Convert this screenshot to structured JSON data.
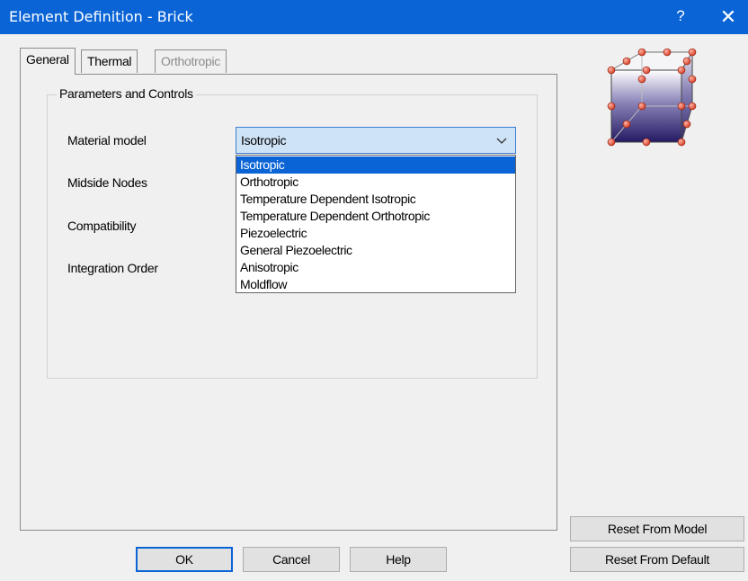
{
  "window": {
    "title": "Element Definition - Brick",
    "help_glyph": "?",
    "close_glyph": "✕"
  },
  "tabs": [
    {
      "label": "General",
      "state": "active"
    },
    {
      "label": "Thermal",
      "state": "normal"
    },
    {
      "label": "Orthotropic",
      "state": "disabled"
    }
  ],
  "group": {
    "title": "Parameters and Controls"
  },
  "fields": {
    "material_model": "Material model",
    "midside_nodes": "Midside Nodes",
    "compatibility": "Compatibility",
    "integration_order": "Integration Order"
  },
  "material_combo": {
    "value": "Isotropic",
    "options": [
      "Isotropic",
      "Orthotropic",
      "Temperature Dependent Isotropic",
      "Temperature Dependent Orthotropic",
      "Piezoelectric",
      "General Piezoelectric",
      "Anisotropic",
      "Moldflow"
    ],
    "selected_index": 0
  },
  "buttons": {
    "ok": "OK",
    "cancel": "Cancel",
    "help": "Help",
    "reset_model": "Reset From Model",
    "reset_default": "Reset From Default"
  },
  "colors": {
    "titlebar": "#0a64d6",
    "selection": "#0a64d6",
    "combo_focus": "#cfe3f7",
    "node": "#e8553f"
  }
}
